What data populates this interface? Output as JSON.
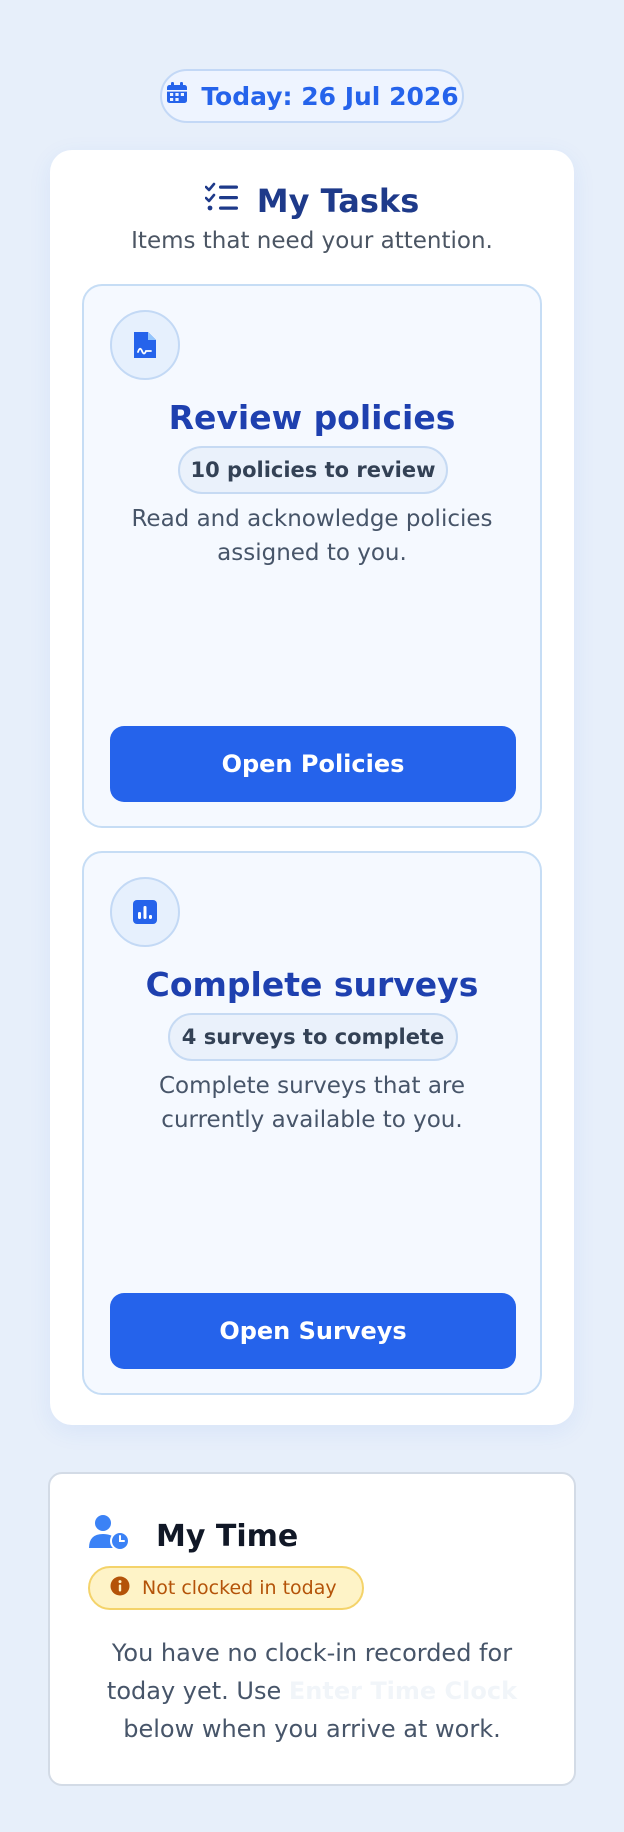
{
  "date_pill": {
    "icon": "calendar-icon",
    "label": "Today: 26 Jul 2026"
  },
  "tasks": {
    "icon": "checklist-icon",
    "title": "My Tasks",
    "subtitle": "Items that need your attention.",
    "items": [
      {
        "icon": "policy-document-icon",
        "title": "Review policies",
        "badge": "10 policies to review",
        "description": "Read and acknowledge policies assigned to you.",
        "button": "Open Policies"
      },
      {
        "icon": "bar-chart-icon",
        "title": "Complete surveys",
        "badge": "4 surveys to complete",
        "description": "Complete surveys that are currently available to you.",
        "button": "Open Surveys"
      }
    ]
  },
  "time": {
    "icon": "user-clock-icon",
    "title": "My Time",
    "status": {
      "icon": "info-icon",
      "label": "Not clocked in today"
    },
    "message_before": "You have no clock-in recorded for today yet. Use ",
    "message_link": "Enter Time Clock",
    "message_after": " below when you arrive at work."
  },
  "colors": {
    "background": "#e7effa",
    "accent": "#2563eb",
    "heading": "#1e3a8a",
    "warning_bg": "#fef3c7",
    "warning_text": "#b45309"
  }
}
